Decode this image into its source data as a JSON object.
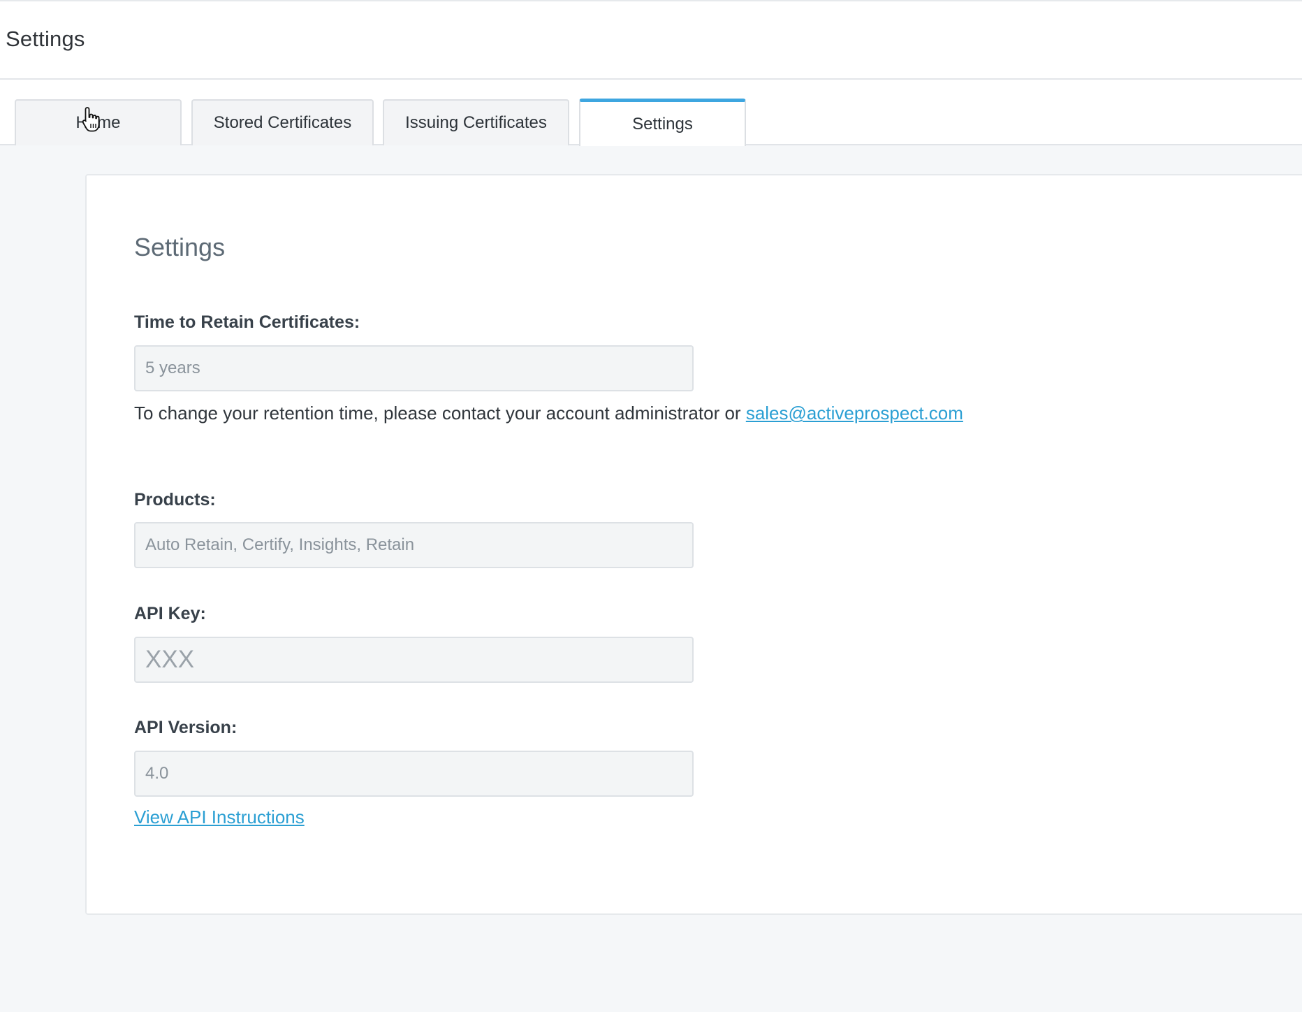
{
  "header": {
    "title": "Settings"
  },
  "tabs": [
    {
      "label": "Home",
      "active": false
    },
    {
      "label": "Stored Certificates",
      "active": false
    },
    {
      "label": "Issuing Certificates",
      "active": false
    },
    {
      "label": "Settings",
      "active": true
    }
  ],
  "settings": {
    "title": "Settings",
    "retention": {
      "label": "Time to Retain Certificates:",
      "value": "5 years",
      "help_text": "To change your retention time, please contact your account administrator or",
      "help_link": "sales@activeprospect.com"
    },
    "products": {
      "label": "Products:",
      "value": "Auto Retain, Certify, Insights, Retain"
    },
    "api_key": {
      "label": "API Key:",
      "value": "XXX"
    },
    "api_version": {
      "label": "API Version:",
      "value": "4.0",
      "link": "View API Instructions"
    }
  },
  "colors": {
    "accent": "#3ea6e0",
    "link": "#2b9fd3",
    "background": "#f5f7f9"
  },
  "icons": {
    "cursor": "hand-pointer-icon"
  }
}
